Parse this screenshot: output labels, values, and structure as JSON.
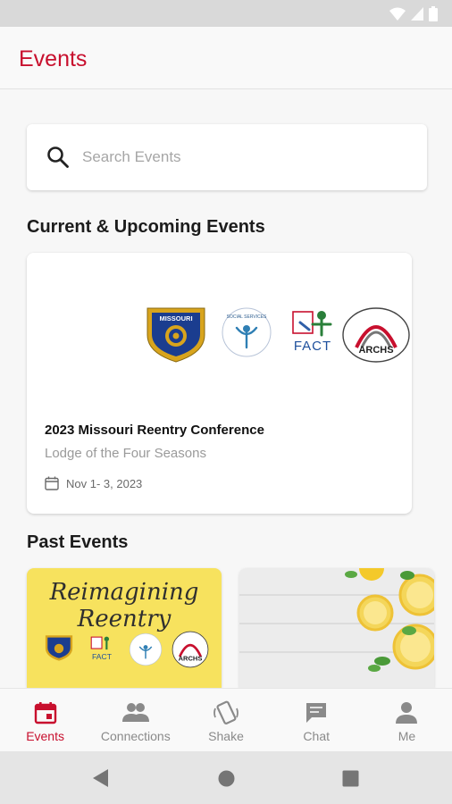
{
  "header": {
    "title": "Events"
  },
  "search": {
    "placeholder": "Search Events"
  },
  "sections": {
    "current": "Current & Upcoming Events",
    "past": "Past Events"
  },
  "current_event": {
    "name": "2023 Missouri Reentry Conference",
    "venue": "Lodge of the Four Seasons",
    "date": "Nov  1- 3, 2023",
    "logo_texts": [
      "MISSOURI",
      "SOCIAL SERVICES",
      "FACT",
      "ARCHS"
    ]
  },
  "past_events": [
    {
      "banner_text": "Reimagining Reentry",
      "logo_texts": [
        "FACT",
        "ARCHS"
      ]
    },
    {
      "banner_text": ""
    }
  ],
  "nav": {
    "items": [
      {
        "label": "Events",
        "icon": "calendar-icon",
        "active": true
      },
      {
        "label": "Connections",
        "icon": "people-icon",
        "active": false
      },
      {
        "label": "Shake",
        "icon": "shake-phone-icon",
        "active": false
      },
      {
        "label": "Chat",
        "icon": "chat-icon",
        "active": false
      },
      {
        "label": "Me",
        "icon": "person-icon",
        "active": false
      }
    ]
  },
  "colors": {
    "accent": "#c8102e",
    "inactive": "#8a8a8a",
    "past_banner_bg": "#f7e25e"
  }
}
